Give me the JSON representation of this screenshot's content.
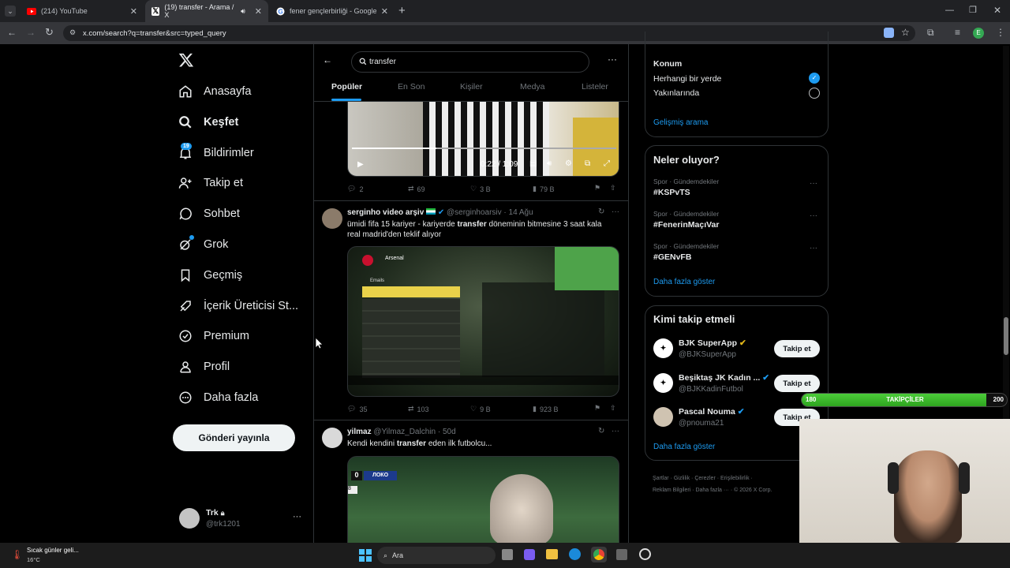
{
  "browser": {
    "tabs": [
      {
        "title": "(214) YouTube"
      },
      {
        "title": "(19) transfer - Arama / X"
      },
      {
        "title": "fener gençlerbirliği - Google'da"
      }
    ],
    "url": "x.com/search?q=transfer&src=typed_query",
    "profile_initial": "E"
  },
  "nav": {
    "items": [
      {
        "label": "Anasayfa",
        "icon": "home-icon"
      },
      {
        "label": "Keşfet",
        "icon": "search-icon"
      },
      {
        "label": "Bildirimler",
        "icon": "bell-icon"
      },
      {
        "label": "Takip et",
        "icon": "add-user-icon"
      },
      {
        "label": "Sohbet",
        "icon": "chat-icon"
      },
      {
        "label": "Grok",
        "icon": "grok-icon"
      },
      {
        "label": "Geçmiş",
        "icon": "bookmark-icon"
      },
      {
        "label": "İçerik Üreticisi St...",
        "icon": "rocket-icon"
      },
      {
        "label": "Premium",
        "icon": "verified-icon"
      },
      {
        "label": "Profil",
        "icon": "person-icon"
      },
      {
        "label": "Daha fazla",
        "icon": "more-circle-icon"
      }
    ],
    "notification_count": "19",
    "post_button": "Gönderi yayınla",
    "account_name": "Trk",
    "account_handle": "@trk1201"
  },
  "search": {
    "query": "transfer",
    "tabs": [
      "Popüler",
      "En Son",
      "Kişiler",
      "Medya",
      "Listeler"
    ]
  },
  "video_time": "0:22 / 1:09",
  "tweets": [
    {
      "replies": "2",
      "reposts": "69",
      "likes": "3 B",
      "views": "79 B"
    },
    {
      "name": "serginho video arşiv",
      "handle": "@serginhoarsiv",
      "time": "14 Ağu",
      "text_before": "ümidi fifa 15 kariyer - kariyerde ",
      "text_bold": "transfer",
      "text_after": " döneminin bitmesine 3 saat kala real madrid'den teklif alıyor",
      "replies": "35",
      "reposts": "103",
      "likes": "9 B",
      "views": "923 B",
      "game_club": "Arsenal",
      "game_menu": "Emails"
    },
    {
      "name": "yilmaz",
      "handle": "@Yilmaz_Dalchin",
      "time": "50d",
      "text_before": "Kendi kendini ",
      "text_bold": "transfer",
      "text_after": " eden ilk futbolcu...",
      "score_home": "0",
      "score_team": "ЛОКО",
      "score_minute": "8"
    }
  ],
  "sidebar": {
    "location_title": "Konum",
    "location_options": [
      "Herhangi bir yerde",
      "Yakınlarında"
    ],
    "advanced_search": "Gelişmiş arama",
    "trends_title": "Neler oluyor?",
    "trends": [
      {
        "category": "Spor · Gündemdekiler",
        "tag": "#KSPvTS"
      },
      {
        "category": "Spor · Gündemdekiler",
        "tag": "#FenerinMaçıVar"
      },
      {
        "category": "Spor · Gündemdekiler",
        "tag": "#GENvFB"
      }
    ],
    "show_more": "Daha fazla göster",
    "who_title": "Kimi takip etmeli",
    "who": [
      {
        "name": "BJK SuperApp",
        "handle": "@BJKSuperApp"
      },
      {
        "name": "Beşiktaş JK Kadın ...",
        "handle": "@BJKKadinFutbol"
      },
      {
        "name": "Pascal Nouma",
        "handle": "@pnouma21"
      }
    ],
    "follow_label": "Takip et",
    "who_show_more": "Daha fazla göster",
    "footer": [
      "Şartlar",
      "Gizlilik",
      "Çerezler",
      "Erişilebilirlik",
      "Reklam Bilgileri",
      "Daha fazla ···",
      "© 2026 X Corp."
    ]
  },
  "overlay": {
    "label": "TAKİPÇİLER",
    "left_value": "180",
    "right_value": "200",
    "progress": 0.9
  },
  "taskbar": {
    "weather_text": "Sıcak günler geli...",
    "temperature": "16°C",
    "search_label": "Ara"
  }
}
